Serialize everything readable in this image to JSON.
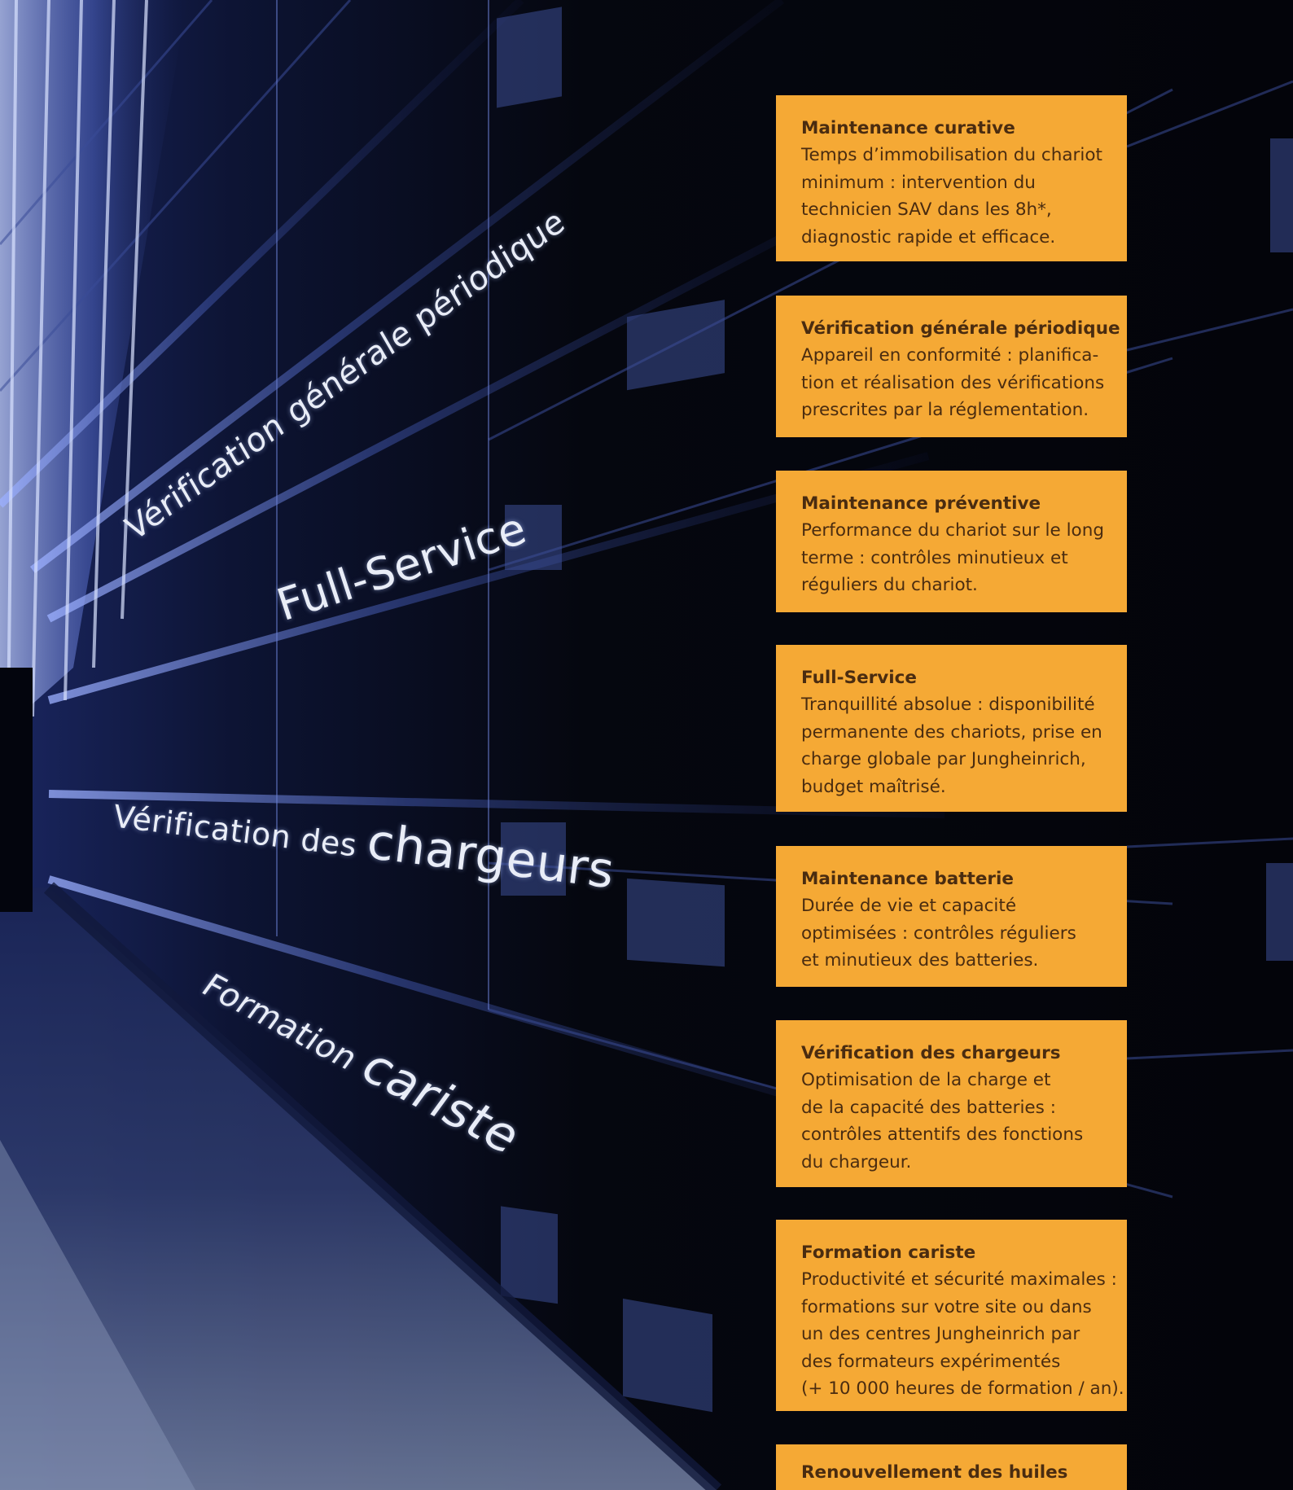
{
  "colors": {
    "card_background": "#f5a935",
    "card_text": "#4a2c10",
    "wall_text": "#e9edf7",
    "backdrop_dark": "#05070d",
    "backdrop_blue": "#2b3f8e"
  },
  "wall_labels": {
    "verification_generale": "Vérification générale périodique",
    "full_service": "Full-Service",
    "verification_chargeurs_small": "Vérification des ",
    "verification_chargeurs_big": "chargeurs",
    "formation_small": "Formation ",
    "formation_big": "cariste"
  },
  "cards": [
    {
      "title": "Maintenance curative",
      "lines": [
        "Temps d’immobilisation du chariot",
        "minimum : intervention du",
        "technicien SAV dans les 8h*,",
        "diagnostic rapide et efficace."
      ]
    },
    {
      "title": "Vérification générale périodique",
      "lines": [
        "Appareil en conformité : planifica-",
        "tion et réalisation des vérifications",
        "prescrites par la réglementation."
      ]
    },
    {
      "title": "Maintenance préventive",
      "lines": [
        "Performance du chariot sur le long",
        "terme : contrôles minutieux et",
        "réguliers du chariot."
      ]
    },
    {
      "title": "Full-Service",
      "lines": [
        "Tranquillité absolue : disponibilité",
        "permanente des chariots, prise en",
        "charge globale par Jungheinrich,",
        "budget maîtrisé."
      ]
    },
    {
      "title": "Maintenance batterie",
      "lines": [
        "Durée de vie et capacité",
        "optimisées : contrôles réguliers",
        "et minutieux des batteries."
      ]
    },
    {
      "title": "Vérification des chargeurs",
      "lines": [
        "Optimisation de la charge et",
        "de la capacité des batteries :",
        "contrôles attentifs des fonctions",
        "du chargeur."
      ]
    },
    {
      "title": "Formation cariste",
      "lines": [
        "Productivité et sécurité maximales :",
        "formations sur votre site ou dans",
        "un des centres Jungheinrich par",
        "des formateurs expérimentés",
        "(+ 10 000 heures de formation / an)."
      ]
    },
    {
      "title": "Renouvellement des huiles",
      "lines": []
    }
  ]
}
